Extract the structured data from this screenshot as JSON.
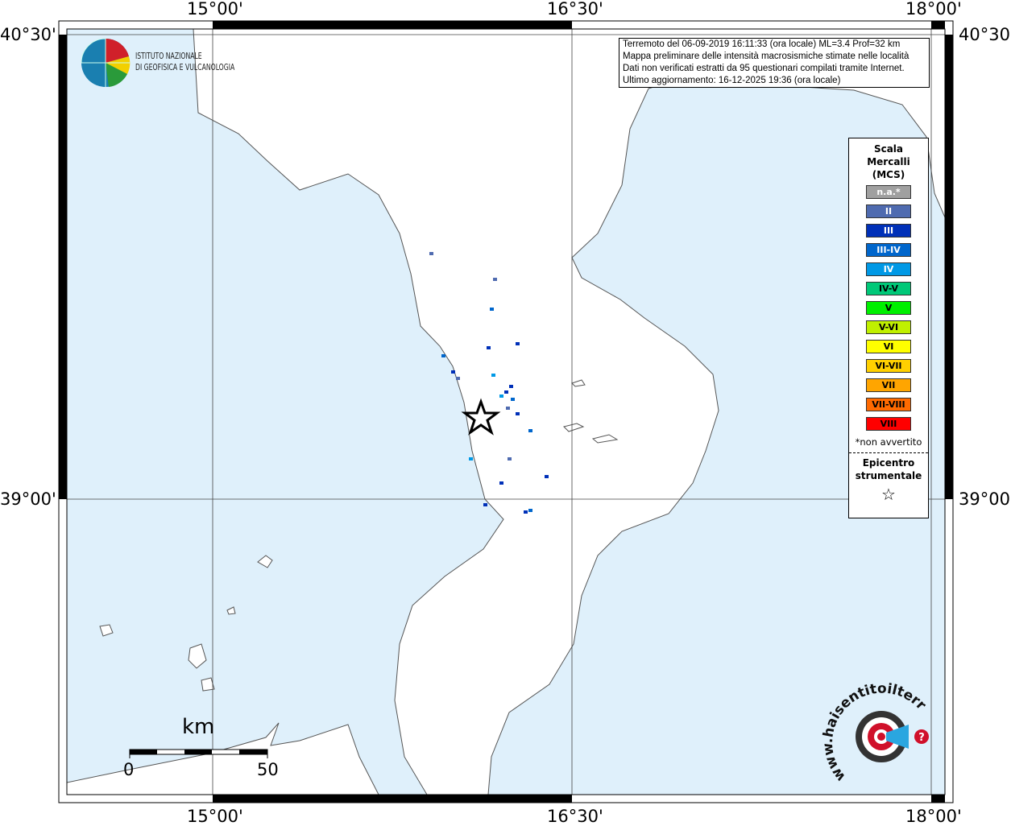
{
  "coords": {
    "top": [
      "15°00'",
      "16°30'",
      "18°00'"
    ],
    "bottom": [
      "15°00'",
      "16°30'",
      "18°00'"
    ],
    "left": [
      "40°30'",
      "39°00'"
    ],
    "right": [
      "40°30'",
      "39°00'"
    ]
  },
  "info": {
    "lines": [
      "Terremoto del 06-09-2019 16:11:33 (ora locale) ML=3.4 Prof=32 km",
      "Mappa preliminare delle intensità macrosismiche stimate nelle località",
      "Dati non verificati estratti da 95 questionari compilati tramite Internet.",
      "Ultimo aggiornamento: 16-12-2025 19:36 (ora locale)"
    ]
  },
  "logo_ingv": {
    "line1": "ISTITUTO NAZIONALE",
    "line2": "DI GEOFISICA E VULCANOLOGIA"
  },
  "logo_hsit": {
    "text": "www.haisentitoilterremoto.it"
  },
  "legend": {
    "title1": "Scala",
    "title2": "Mercalli",
    "title3": "(MCS)",
    "items": [
      {
        "label": "n.a.*",
        "color": "#a0a0a0",
        "text_color": "#ffffff"
      },
      {
        "label": "II",
        "color": "#4f6bb0",
        "text_color": "#ffffff"
      },
      {
        "label": "III",
        "color": "#0030b8",
        "text_color": "#ffffff"
      },
      {
        "label": "III-IV",
        "color": "#0066cc",
        "text_color": "#ffffff"
      },
      {
        "label": "IV",
        "color": "#0099e6",
        "text_color": "#ffffff"
      },
      {
        "label": "IV-V",
        "color": "#00c878",
        "text_color": "#000000"
      },
      {
        "label": "V",
        "color": "#00f000",
        "text_color": "#000000"
      },
      {
        "label": "V-VI",
        "color": "#c0f000",
        "text_color": "#000000"
      },
      {
        "label": "VI",
        "color": "#ffff00",
        "text_color": "#000000"
      },
      {
        "label": "VI-VII",
        "color": "#ffd000",
        "text_color": "#000000"
      },
      {
        "label": "VII",
        "color": "#ffa500",
        "text_color": "#000000"
      },
      {
        "label": "VII-VIII",
        "color": "#ff6a00",
        "text_color": "#000000"
      },
      {
        "label": "VIII",
        "color": "#ff0000",
        "text_color": "#000000"
      }
    ],
    "note": "*non avvertito",
    "epicenter1": "Epicentro",
    "epicenter2": "strumentale",
    "epicenter_symbol": "☆"
  },
  "scale_bar": {
    "unit": "km",
    "min": "0",
    "max": "50"
  },
  "colors": {
    "sea": "#dff0fb",
    "land": "#ffffff",
    "coast": "#555555"
  }
}
